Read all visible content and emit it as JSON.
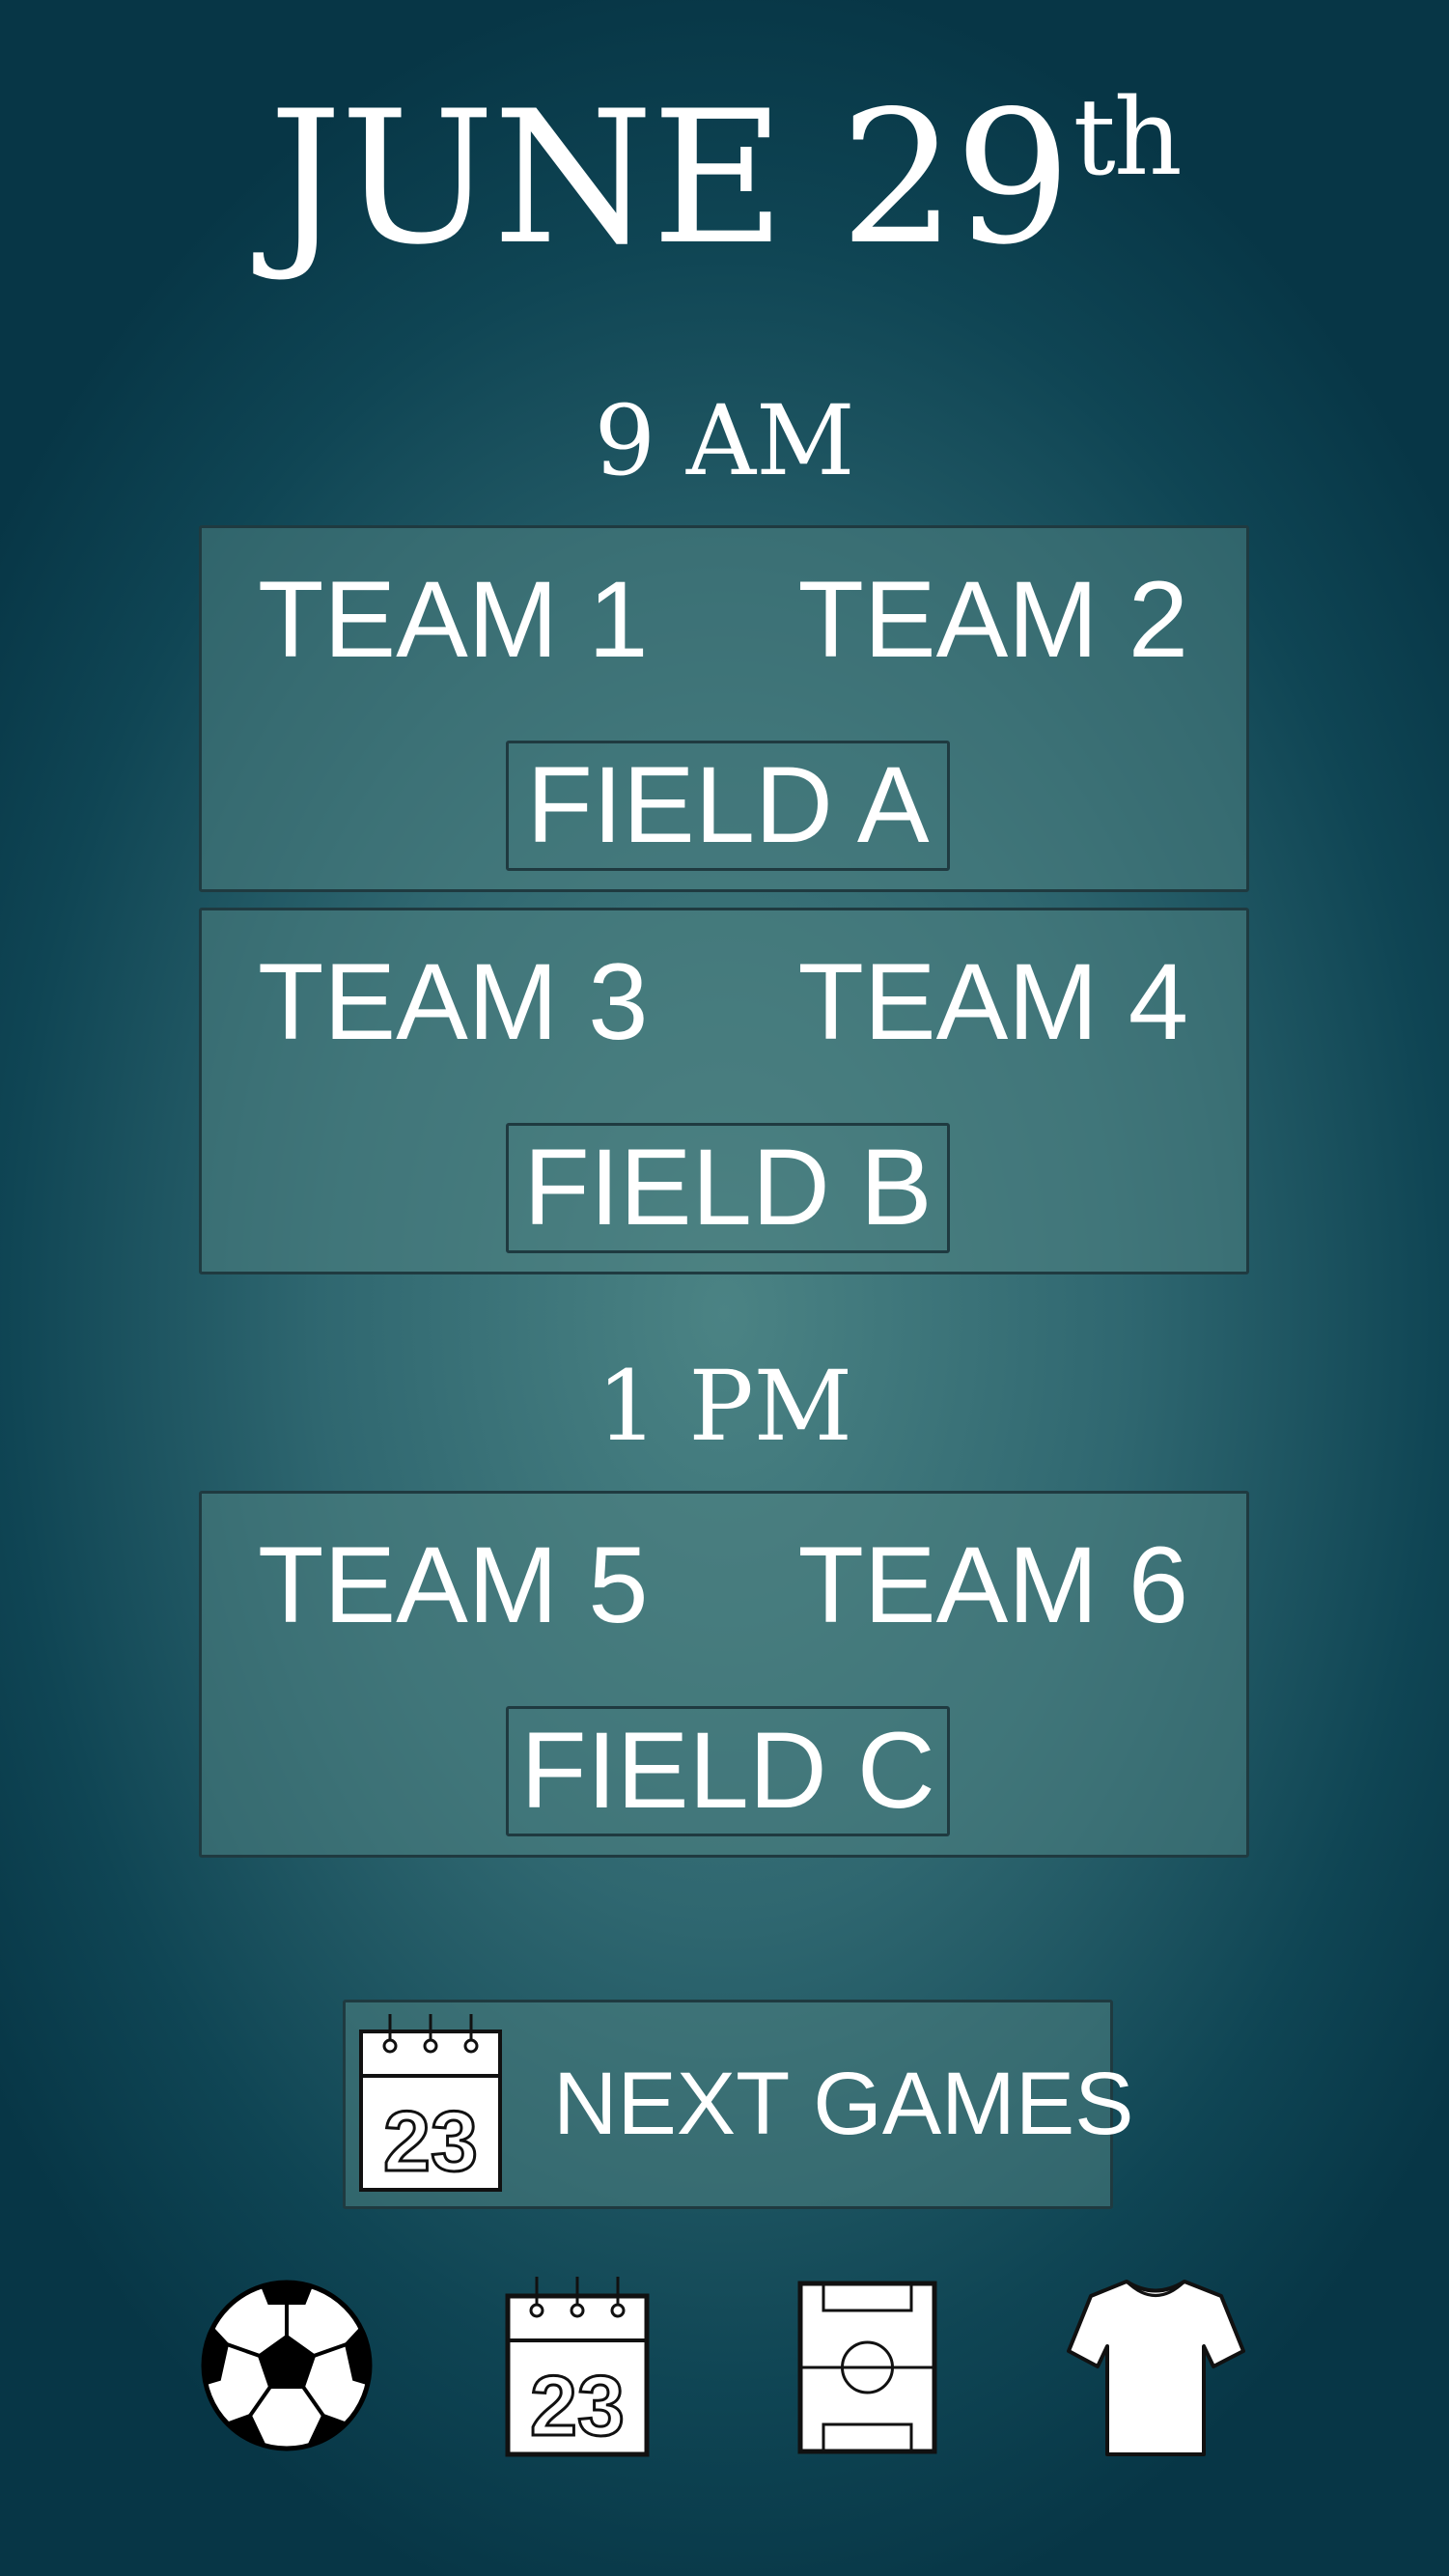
{
  "header": {
    "date_main": "JUNE 29",
    "date_suffix": "th"
  },
  "sessions": [
    {
      "time": "9 AM",
      "matches": [
        {
          "team_home": "TEAM 1",
          "team_away": "TEAM 2",
          "field": "FIELD A"
        },
        {
          "team_home": "TEAM 3",
          "team_away": "TEAM 4",
          "field": "FIELD B"
        }
      ]
    },
    {
      "time": "1 PM",
      "matches": [
        {
          "team_home": "TEAM 5",
          "team_away": "TEAM 6",
          "field": "FIELD C"
        }
      ]
    }
  ],
  "next_games": {
    "label": "NEXT GAMES",
    "icon": "calendar-icon",
    "calendar_day": "23"
  },
  "bottom_nav": [
    {
      "icon": "soccer-ball-icon"
    },
    {
      "icon": "calendar-icon",
      "calendar_day": "23"
    },
    {
      "icon": "soccer-field-icon"
    },
    {
      "icon": "jersey-icon"
    }
  ],
  "colors": {
    "background_center": "#4b8384",
    "background_edge": "#073646",
    "card_border": "#1f3a40",
    "text": "#ffffff"
  }
}
